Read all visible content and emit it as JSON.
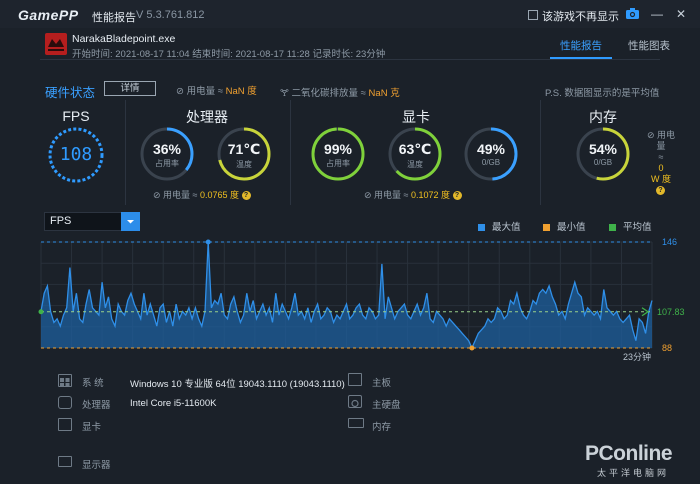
{
  "titlebar": {
    "logo": "GamePP",
    "title": "性能报告",
    "version": "V 5.3.761.812",
    "hide_checkbox_label": "该游戏不再显示",
    "hide_checked": false
  },
  "session": {
    "exe": "NarakaBladepoint.exe",
    "times": "开始时间: 2021-08-17 11:04   结束时间: 2021-08-17 11:28   记录时长: 23分钟"
  },
  "tabs": [
    {
      "label": "性能报告",
      "active": true
    },
    {
      "label": "性能图表",
      "active": false
    }
  ],
  "hardware": {
    "title": "硬件状态",
    "detail_button": "详情",
    "power_label": "用电量 ≈ ",
    "power_value": "NaN 度",
    "co2_label": "二氧化碳排放量 ≈ ",
    "co2_value": "NaN 克",
    "note": "P.S. 数据图显示的是平均值"
  },
  "fps_panel": {
    "title": "FPS",
    "value": "108"
  },
  "cpu": {
    "title": "处理器",
    "usage_value": "36%",
    "usage_label": "占用率",
    "usage_level": 36,
    "temp_value": "71℃",
    "temp_label": "温度",
    "temp_level": 71,
    "power_label": "用电量 ≈ ",
    "power_value": "0.0765 度"
  },
  "gpu": {
    "title": "显卡",
    "usage_value": "99%",
    "usage_label": "占用率",
    "usage_level": 99,
    "temp_value": "63℃",
    "temp_label": "温度",
    "temp_level": 63,
    "vram_value": "49%",
    "vram_label": "0/GB",
    "vram_level": 49,
    "power_label": "用电量 ≈ ",
    "power_value": "0.1072 度"
  },
  "memory": {
    "title": "内存",
    "usage_value": "54%",
    "usage_label": "0/GB",
    "usage_level": 54,
    "power_line1": "用电",
    "power_line2": "量",
    "power_line3": "≈",
    "power_line4": "0",
    "power_line5": "W 度"
  },
  "chart_controls": {
    "selected_metric": "FPS",
    "legend": [
      {
        "label": "最大值",
        "color": "#2f8fe8"
      },
      {
        "label": "最小值",
        "color": "#f0a030"
      },
      {
        "label": "平均值",
        "color": "#3fb24a"
      }
    ]
  },
  "chart_data": {
    "type": "area",
    "title": "",
    "xlabel": "",
    "ylabel": "FPS",
    "ylim": [
      88,
      146
    ],
    "max": 146,
    "min": 88,
    "avg": 107.83,
    "max_label": "146",
    "min_label": "88",
    "avg_label": "107.83",
    "x_end_label": "23分钟",
    "series_color": "#2f8fe8",
    "values": [
      108,
      118,
      122,
      108,
      102,
      104,
      100,
      106,
      110,
      132,
      108,
      118,
      104,
      102,
      112,
      120,
      110,
      108,
      106,
      124,
      110,
      116,
      104,
      100,
      112,
      108,
      106,
      114,
      118,
      112,
      108,
      104,
      118,
      106,
      112,
      106,
      100,
      110,
      112,
      102,
      108,
      100,
      112,
      104,
      108,
      106,
      110,
      104,
      110,
      104,
      100,
      108,
      146,
      110,
      114,
      112,
      118,
      106,
      104,
      112,
      116,
      108,
      102,
      106,
      118,
      108,
      114,
      104,
      108,
      112,
      106,
      110,
      102,
      118,
      106,
      112,
      108,
      104,
      110,
      118,
      106,
      108,
      104,
      110,
      102,
      108,
      112,
      104,
      106,
      110,
      108,
      102,
      106,
      104,
      108,
      112,
      104,
      106,
      110,
      112,
      106,
      104,
      110,
      108,
      104,
      106,
      134,
      104,
      116,
      110,
      104,
      108,
      110,
      112,
      106,
      104,
      108,
      112,
      106,
      110,
      118,
      104,
      102,
      108,
      106,
      104,
      100,
      104,
      102,
      100,
      98,
      96,
      94,
      92,
      88,
      92,
      96,
      98,
      100,
      104,
      102,
      104,
      110,
      108,
      104,
      106,
      114,
      112,
      118,
      110,
      106,
      104,
      108,
      114,
      112,
      118,
      120,
      118,
      122,
      116,
      112,
      106,
      108,
      104,
      112,
      118,
      124,
      118,
      116,
      106,
      110,
      108,
      106,
      108,
      104,
      120,
      110,
      108,
      106,
      108,
      104,
      102,
      104,
      106,
      98,
      92,
      104,
      102,
      96,
      108,
      114
    ]
  },
  "system": {
    "os_label": "系 统",
    "os_value": "Windows 10 专业版 64位   19043.1110 (19043.1110)",
    "cpu_label": "处理器",
    "cpu_value": "Intel Core i5-11600K",
    "gpu_label": "显卡",
    "gpu_value": "",
    "display_label": "显示器",
    "board_label": "主板",
    "disk_label": "主硬盘",
    "ram_label": "内存"
  },
  "watermark": {
    "brand": "PConline",
    "sub": "太平洋电脑网"
  }
}
